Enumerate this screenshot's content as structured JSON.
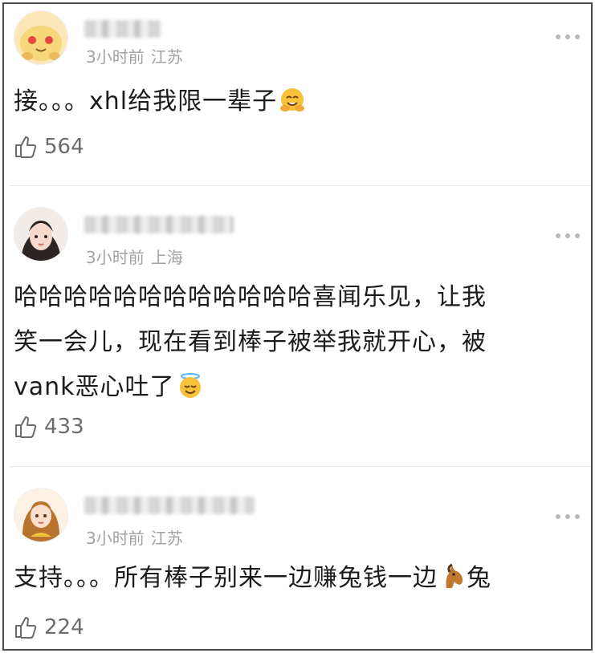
{
  "comments": [
    {
      "time": "3小时前",
      "location": "江苏",
      "text": "接。。。xhl给我限一辈子",
      "emoji": "hugging-face-emoji",
      "likes": "564"
    },
    {
      "time": "3小时前",
      "location": "上海",
      "line1": "哈哈哈哈哈哈哈哈哈哈哈哈喜闻乐见，让我",
      "line2": "笑一会儿，现在看到棒子被举我就开心，被",
      "line3": "vank恶心吐了",
      "emoji": "smiling-face-with-halo-emoji",
      "likes": "433"
    },
    {
      "time": "3小时前",
      "location": "江苏",
      "text_part1": "支持。。。所有棒子别来一边赚兔钱一边",
      "text_part2": "兔",
      "emoji": "horse-face-emoji",
      "likes": "224"
    }
  ],
  "icons": {
    "like": "thumbs-up-icon",
    "more": "more-dots-icon"
  },
  "colors": {
    "text": "#1b1b1b",
    "meta": "#a2a2a2",
    "like": "#6b6b6b",
    "border": "#4a4a4a",
    "divider": "#e6e6e6"
  }
}
